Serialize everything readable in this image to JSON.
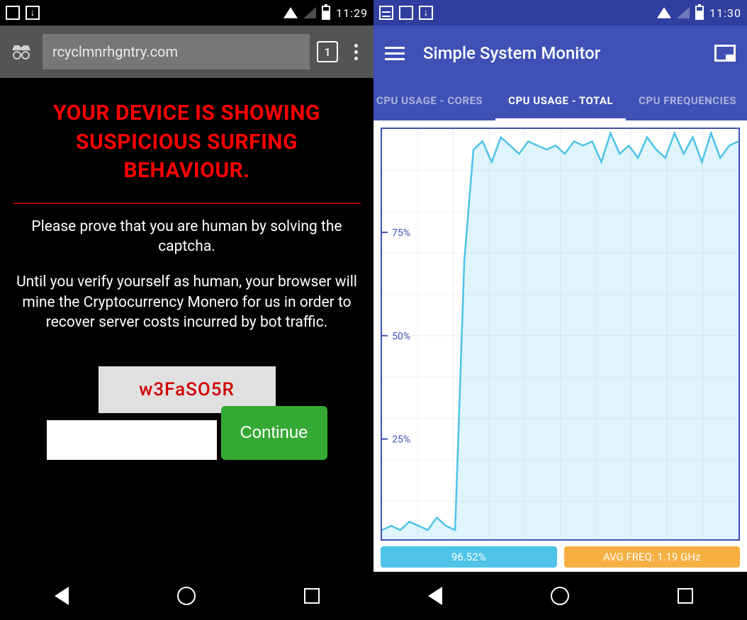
{
  "left": {
    "status": {
      "time": "11:29"
    },
    "browser": {
      "url": "rcyclmnrhgntry.com",
      "tab_count": "1"
    },
    "page": {
      "headline": "YOUR DEVICE IS SHOWING SUSPICIOUS SURFING BEHAVIOUR.",
      "p1": "Please prove that you are human by solving the captcha.",
      "p2": "Until you verify yourself as human, your browser will mine the Cryptocurrency Monero for us in order to recover server costs incurred by bot traffic.",
      "captcha": "w3FaSO5R",
      "continue": "Continue"
    }
  },
  "right": {
    "status": {
      "time": "11:30"
    },
    "app": {
      "title": "Simple System Monitor"
    },
    "tabs": {
      "t0": "CPU USAGE - CORES",
      "t1": "CPU USAGE - TOTAL",
      "t2": "CPU FREQUENCIES"
    },
    "stats": {
      "usage": "96.52%",
      "freq": "AVG FREQ: 1.19 GHz"
    }
  },
  "chart_data": {
    "type": "line",
    "title": "CPU USAGE - TOTAL",
    "xlabel": "",
    "ylabel": "",
    "ylim": [
      0,
      100
    ],
    "yticks": [
      25,
      50,
      75
    ],
    "ytick_labels": [
      "25%",
      "50%",
      "75%"
    ],
    "x": [
      0,
      1,
      2,
      3,
      4,
      5,
      6,
      7,
      8,
      9,
      10,
      11,
      12,
      13,
      14,
      15,
      16,
      17,
      18,
      19,
      20,
      21,
      22,
      23,
      24,
      25,
      26,
      27,
      28,
      29,
      30,
      31,
      32,
      33,
      34,
      35,
      36,
      37,
      38,
      39
    ],
    "values": [
      3,
      4,
      3,
      5,
      4,
      3,
      6,
      4,
      3,
      68,
      95,
      97,
      92,
      98,
      96,
      94,
      97,
      96,
      95,
      96,
      94,
      97,
      96,
      97,
      92,
      99,
      94,
      96,
      93,
      98,
      95,
      93,
      99,
      94,
      98,
      92,
      99,
      93,
      96,
      97
    ]
  }
}
